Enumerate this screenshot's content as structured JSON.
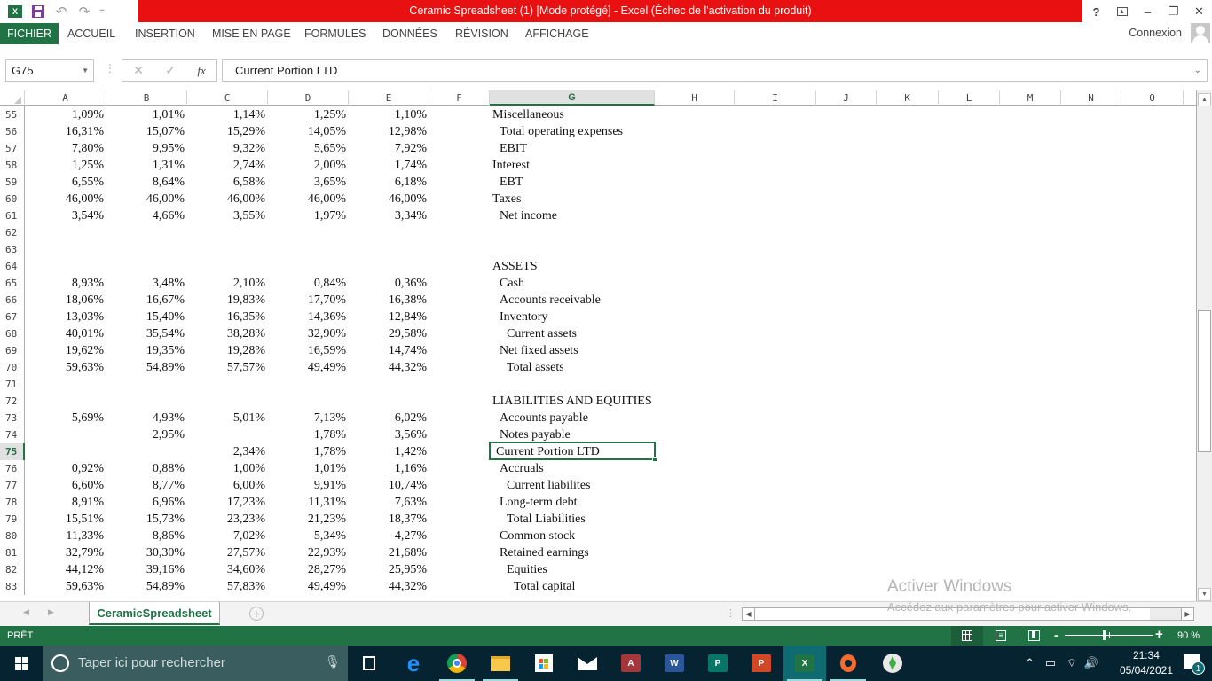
{
  "window": {
    "title": "Ceramic Spreadsheet (1)  [Mode protégé] -  Excel (Échec de l'activation du produit)",
    "controls": {
      "help": "?",
      "ribbon_display": "⊼",
      "minimize": "–",
      "restore": "❐",
      "close": "✕"
    }
  },
  "quick_access": {
    "app_icon": "X≣",
    "save": "💾",
    "undo": "↶",
    "redo": "↷",
    "customize": "="
  },
  "ribbon": {
    "tabs": [
      {
        "label": "FICHIER",
        "active": true
      },
      {
        "label": "ACCUEIL"
      },
      {
        "label": "INSERTION"
      },
      {
        "label": "MISE EN PAGE"
      },
      {
        "label": "FORMULES"
      },
      {
        "label": "DONNÉES"
      },
      {
        "label": "RÉVISION"
      },
      {
        "label": "AFFICHAGE"
      }
    ],
    "signin_label": "Connexion"
  },
  "formula_bar": {
    "name_box": "G75",
    "cancel": "✕",
    "enter": "✓",
    "fx": "fx",
    "content": "Current Portion LTD"
  },
  "sheet": {
    "columns": [
      "A",
      "B",
      "C",
      "D",
      "E",
      "F",
      "G",
      "H",
      "I",
      "J",
      "K",
      "L",
      "M",
      "N",
      "O"
    ],
    "selected_column": "G",
    "selected_row": "75",
    "selected_cell": "G75",
    "rows": [
      {
        "n": "55",
        "values": [
          "1,09%",
          "1,01%",
          "1,14%",
          "1,25%",
          "1,10%"
        ],
        "label": "Miscellaneous",
        "indent": 0
      },
      {
        "n": "56",
        "values": [
          "16,31%",
          "15,07%",
          "15,29%",
          "14,05%",
          "12,98%"
        ],
        "label": "Total operating expenses",
        "indent": 1
      },
      {
        "n": "57",
        "values": [
          "7,80%",
          "9,95%",
          "9,32%",
          "5,65%",
          "7,92%"
        ],
        "label": "EBIT",
        "indent": 1
      },
      {
        "n": "58",
        "values": [
          "1,25%",
          "1,31%",
          "2,74%",
          "2,00%",
          "1,74%"
        ],
        "label": "Interest",
        "indent": 0
      },
      {
        "n": "59",
        "values": [
          "6,55%",
          "8,64%",
          "6,58%",
          "3,65%",
          "6,18%"
        ],
        "label": "EBT",
        "indent": 1
      },
      {
        "n": "60",
        "values": [
          "46,00%",
          "46,00%",
          "46,00%",
          "46,00%",
          "46,00%"
        ],
        "label": "Taxes",
        "indent": 0
      },
      {
        "n": "61",
        "values": [
          "3,54%",
          "4,66%",
          "3,55%",
          "1,97%",
          "3,34%"
        ],
        "label": "Net income",
        "indent": 1
      },
      {
        "n": "62",
        "values": [
          "",
          "",
          "",
          "",
          ""
        ],
        "label": "",
        "indent": 0
      },
      {
        "n": "63",
        "values": [
          "",
          "",
          "",
          "",
          ""
        ],
        "label": "",
        "indent": 0
      },
      {
        "n": "64",
        "values": [
          "",
          "",
          "",
          "",
          ""
        ],
        "label": "ASSETS",
        "indent": 0
      },
      {
        "n": "65",
        "values": [
          "8,93%",
          "3,48%",
          "2,10%",
          "0,84%",
          "0,36%"
        ],
        "label": "Cash",
        "indent": 1
      },
      {
        "n": "66",
        "values": [
          "18,06%",
          "16,67%",
          "19,83%",
          "17,70%",
          "16,38%"
        ],
        "label": "Accounts receivable",
        "indent": 1
      },
      {
        "n": "67",
        "values": [
          "13,03%",
          "15,40%",
          "16,35%",
          "14,36%",
          "12,84%"
        ],
        "label": "Inventory",
        "indent": 1
      },
      {
        "n": "68",
        "values": [
          "40,01%",
          "35,54%",
          "38,28%",
          "32,90%",
          "29,58%"
        ],
        "label": "Current assets",
        "indent": 2
      },
      {
        "n": "69",
        "values": [
          "19,62%",
          "19,35%",
          "19,28%",
          "16,59%",
          "14,74%"
        ],
        "label": "Net fixed assets",
        "indent": 1
      },
      {
        "n": "70",
        "values": [
          "59,63%",
          "54,89%",
          "57,57%",
          "49,49%",
          "44,32%"
        ],
        "label": "Total assets",
        "indent": 2
      },
      {
        "n": "71",
        "values": [
          "",
          "",
          "",
          "",
          ""
        ],
        "label": "",
        "indent": 0
      },
      {
        "n": "72",
        "values": [
          "",
          "",
          "",
          "",
          ""
        ],
        "label": "LIABILITIES AND EQUITIES",
        "indent": 0
      },
      {
        "n": "73",
        "values": [
          "5,69%",
          "4,93%",
          "5,01%",
          "7,13%",
          "6,02%"
        ],
        "label": "Accounts payable",
        "indent": 1
      },
      {
        "n": "74",
        "values": [
          "",
          "2,95%",
          "",
          "1,78%",
          "3,56%"
        ],
        "label": "Notes payable",
        "indent": 1
      },
      {
        "n": "75",
        "values": [
          "",
          "",
          "2,34%",
          "1,78%",
          "1,42%"
        ],
        "label": "Current Portion LTD",
        "indent": 0.5
      },
      {
        "n": "76",
        "values": [
          "0,92%",
          "0,88%",
          "1,00%",
          "1,01%",
          "1,16%"
        ],
        "label": "Accruals",
        "indent": 1
      },
      {
        "n": "77",
        "values": [
          "6,60%",
          "8,77%",
          "6,00%",
          "9,91%",
          "10,74%"
        ],
        "label": "Current liabilites",
        "indent": 2
      },
      {
        "n": "78",
        "values": [
          "8,91%",
          "6,96%",
          "17,23%",
          "11,31%",
          "7,63%"
        ],
        "label": "Long-term debt",
        "indent": 1
      },
      {
        "n": "79",
        "values": [
          "15,51%",
          "15,73%",
          "23,23%",
          "21,23%",
          "18,37%"
        ],
        "label": "Total Liabilities",
        "indent": 2
      },
      {
        "n": "80",
        "values": [
          "11,33%",
          "8,86%",
          "7,02%",
          "5,34%",
          "4,27%"
        ],
        "label": "Common stock",
        "indent": 1
      },
      {
        "n": "81",
        "values": [
          "32,79%",
          "30,30%",
          "27,57%",
          "22,93%",
          "21,68%"
        ],
        "label": "Retained earnings",
        "indent": 1
      },
      {
        "n": "82",
        "values": [
          "44,12%",
          "39,16%",
          "34,60%",
          "28,27%",
          "25,95%"
        ],
        "label": "Equities",
        "indent": 2
      },
      {
        "n": "83",
        "values": [
          "59,63%",
          "54,89%",
          "57,83%",
          "49,49%",
          "44,32%"
        ],
        "label": "Total capital",
        "indent": 3
      }
    ]
  },
  "sheet_tabs": {
    "tabs": [
      "CeramicSpreadsheet"
    ],
    "active": "CeramicSpreadsheet",
    "add_label": "+"
  },
  "watermark": {
    "line1": "Activer Windows",
    "line2": "Accédez aux paramètres pour activer Windows."
  },
  "status_bar": {
    "status": "PRÊT",
    "zoom_level": "90 %",
    "zoom_percent": 90
  },
  "taskbar": {
    "search_placeholder": "Taper ici pour rechercher",
    "apps": [
      "task-view",
      "edge",
      "chrome",
      "file-explorer",
      "store",
      "mail",
      "access",
      "word",
      "publisher",
      "powerpoint",
      "excel",
      "origin",
      "sims"
    ],
    "active_app": "excel",
    "time": "21:34",
    "date": "05/04/2021",
    "notification_count": "1"
  }
}
